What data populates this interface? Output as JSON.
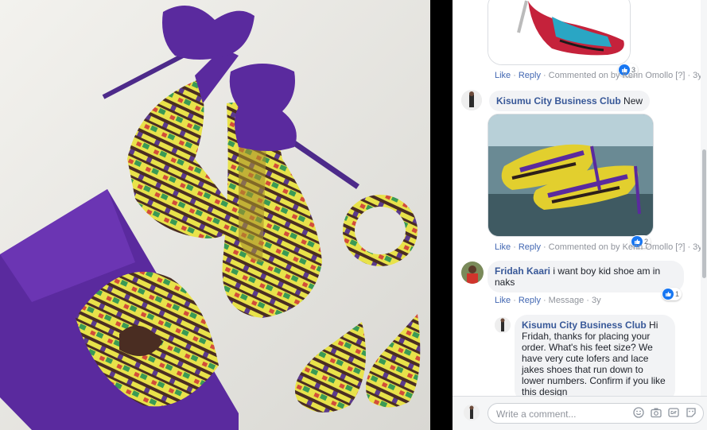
{
  "photo": {
    "alt": "Ankara print heels, clutch, bangle and earrings"
  },
  "comments": [
    {
      "actions": {
        "like": "Like",
        "reply": "Reply",
        "meta": "Commented on by Kenn Omollo",
        "help": "[?]",
        "time": "3y"
      },
      "reactions": "3"
    },
    {
      "author": "Kisumu City Business Club",
      "text": "New",
      "actions": {
        "like": "Like",
        "reply": "Reply",
        "meta": "Commented on by Kenn Omollo",
        "help": "[?]",
        "time": "3y"
      },
      "reactions": "2"
    },
    {
      "author": "Fridah Kaari",
      "text": "i want boy kid shoe am in naks",
      "actions": {
        "like": "Like",
        "reply": "Reply",
        "meta": "Message",
        "time": "3y"
      },
      "reactions": "1"
    },
    {
      "author": "Kisumu City Business Club",
      "text": "Hi Fridah, thanks for placing your order. What's his feet size? We have very cute lofers and lace jakes shoes that run down to lower numbers. Confirm if you like this design"
    }
  ],
  "composer": {
    "placeholder": "Write a comment..."
  },
  "colors": {
    "link": "#4267b2",
    "author": "#385898",
    "like": "#1877f2",
    "bubble": "#f2f3f5"
  }
}
